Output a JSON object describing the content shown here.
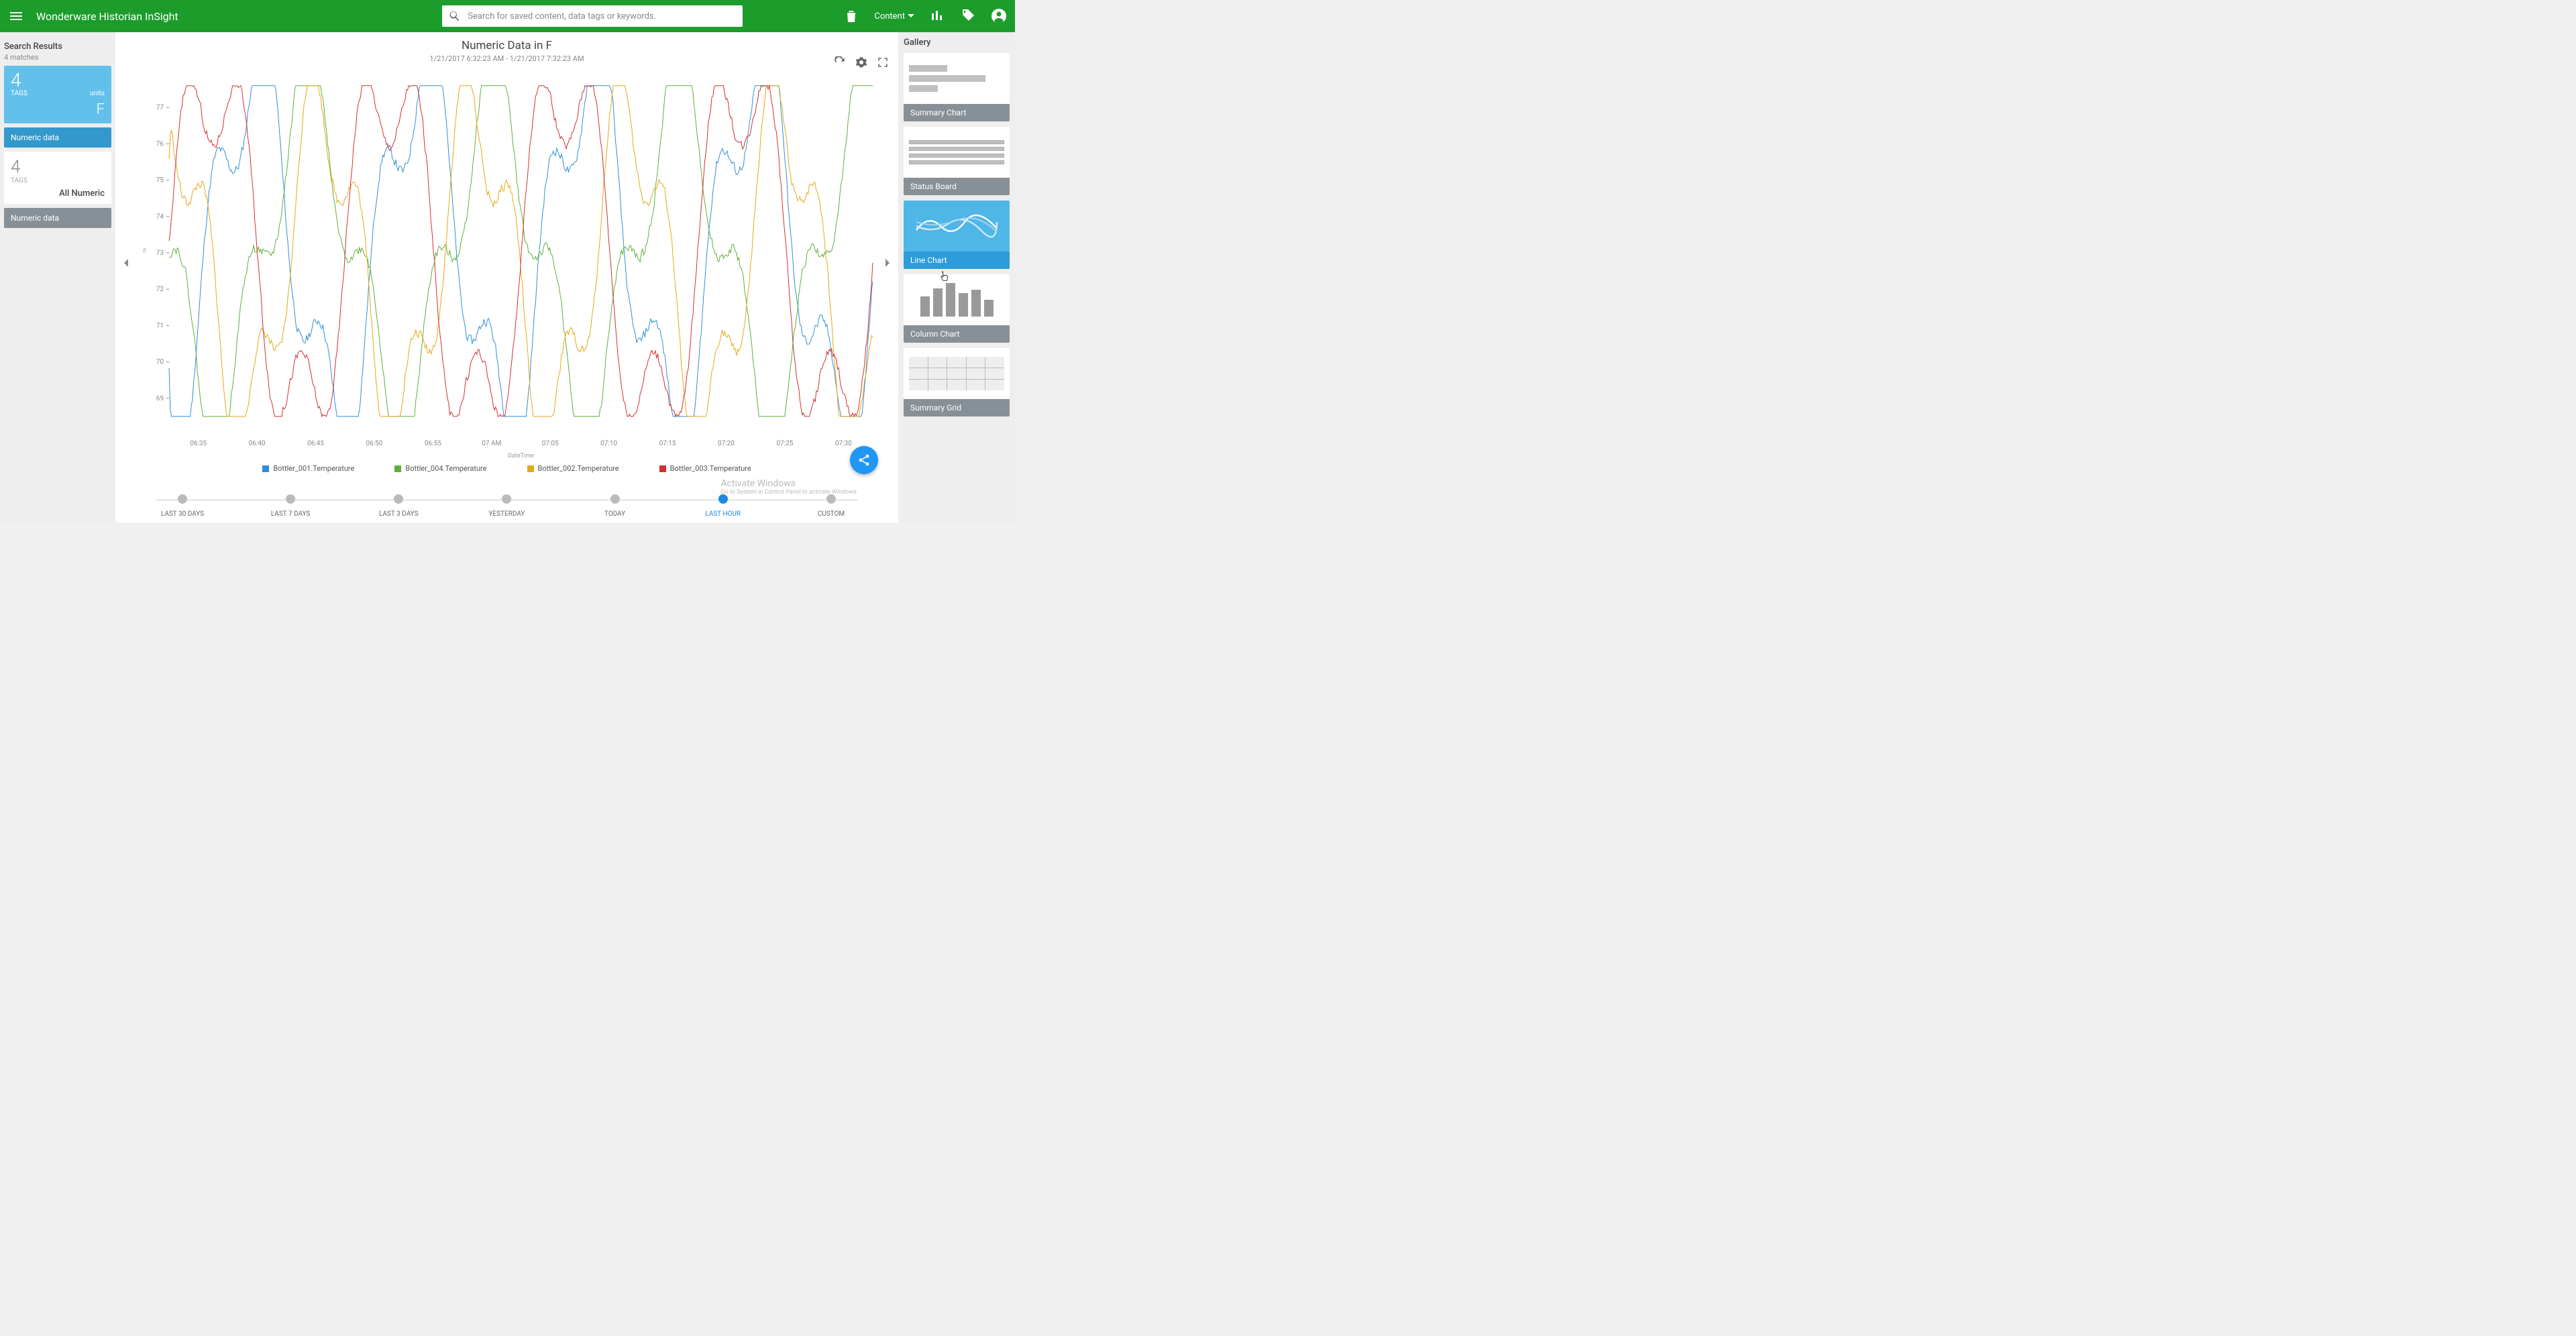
{
  "header": {
    "title": "Wonderware Historian InSight",
    "search_placeholder": "Search for saved content, data tags or keywords.",
    "content_label": "Content"
  },
  "left": {
    "title": "Search Results",
    "matches": "4 matches",
    "card1": {
      "count": "4",
      "tags": "TAGS",
      "units": "units",
      "unit_value": "F",
      "label": "Numeric data"
    },
    "card2": {
      "count": "4",
      "tags": "TAGS",
      "allnum": "All Numeric",
      "label": "Numeric data"
    }
  },
  "chart": {
    "title": "Numeric Data in F",
    "subtitle": "1/21/2017 6:32:23 AM - 1/21/2017 7:32:23 AM",
    "xlabel": "DateTime",
    "ylabel": "F"
  },
  "chart_data": {
    "type": "line",
    "xlabel": "DateTime",
    "ylabel": "F",
    "ylim": [
      68,
      78
    ],
    "x_ticks": [
      "06:35",
      "06:40",
      "06:45",
      "06:50",
      "06:55",
      "07 AM",
      "07:05",
      "07:10",
      "07:15",
      "07:20",
      "07:25",
      "07:30"
    ],
    "y_ticks": [
      69,
      70,
      71,
      72,
      73,
      74,
      75,
      76,
      77
    ],
    "series": [
      {
        "name": "Bottler_001.Temperature",
        "color": "#2e8fd8"
      },
      {
        "name": "Bottler_004.Temperature",
        "color": "#5cb038"
      },
      {
        "name": "Bottler_002.Temperature",
        "color": "#e6a817"
      },
      {
        "name": "Bottler_003.Temperature",
        "color": "#d32f2f"
      }
    ],
    "note": "Dense noisy 4-series trend data oscillating roughly between 68.5 and 77.5 over one hour; exact values not labeled."
  },
  "timeline": [
    {
      "label": "LAST 30 DAYS",
      "active": false
    },
    {
      "label": "LAST 7 DAYS",
      "active": false
    },
    {
      "label": "LAST 3 DAYS",
      "active": false
    },
    {
      "label": "YESTERDAY",
      "active": false
    },
    {
      "label": "TODAY",
      "active": false
    },
    {
      "label": "LAST HOUR",
      "active": true
    },
    {
      "label": "CUSTOM",
      "active": false
    }
  ],
  "gallery": {
    "title": "Gallery",
    "items": [
      {
        "label": "Summary Chart",
        "type": "summary",
        "selected": false
      },
      {
        "label": "Status Board",
        "type": "status",
        "selected": false
      },
      {
        "label": "Line Chart",
        "type": "line",
        "selected": true
      },
      {
        "label": "Column Chart",
        "type": "column",
        "selected": false
      },
      {
        "label": "Summary Grid",
        "type": "grid",
        "selected": false
      }
    ]
  },
  "watermark": {
    "l1": "Activate Windows",
    "l2": "Go to System in Control Panel to activate Windows."
  },
  "colors": {
    "brand": "#1c9c2b",
    "accent": "#2196f3",
    "sel": "#4fb6e8"
  }
}
